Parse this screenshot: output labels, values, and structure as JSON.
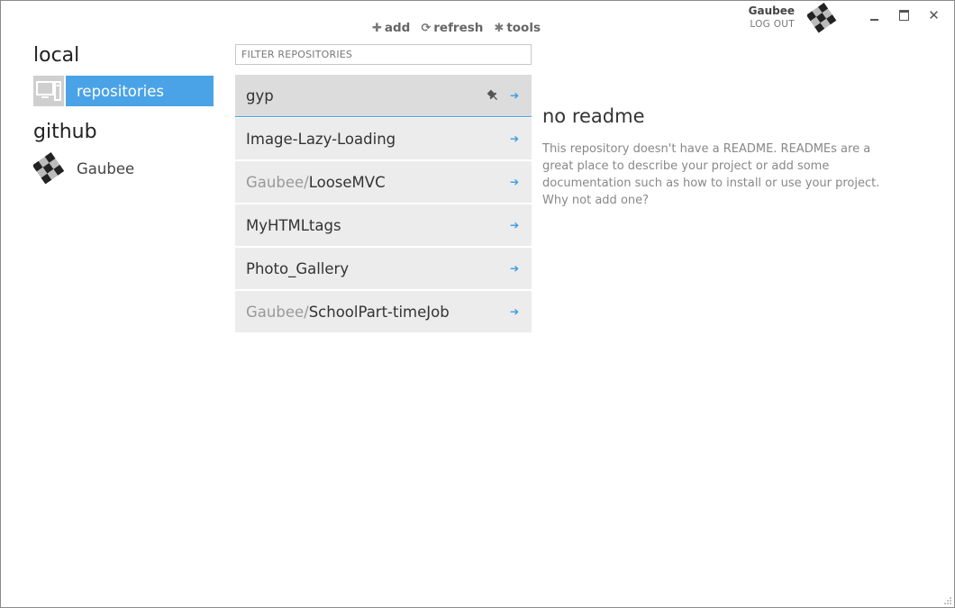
{
  "user": {
    "name": "Gaubee",
    "logout_label": "LOG OUT"
  },
  "toolbar": {
    "add_label": "add",
    "refresh_label": "refresh",
    "tools_label": "tools"
  },
  "sidebar": {
    "local_title": "local",
    "repositories_label": "repositories",
    "github_title": "github",
    "github_account": "Gaubee"
  },
  "filter": {
    "placeholder": "FILTER REPOSITORIES"
  },
  "repos": [
    {
      "owner": "",
      "name": "gyp",
      "selected": true,
      "pinned": true
    },
    {
      "owner": "",
      "name": "Image-Lazy-Loading"
    },
    {
      "owner": "Gaubee/",
      "name": "LooseMVC"
    },
    {
      "owner": "",
      "name": "MyHTMLtags"
    },
    {
      "owner": "",
      "name": "Photo_Gallery"
    },
    {
      "owner": "Gaubee/",
      "name": "SchoolPart-timeJob"
    }
  ],
  "readme": {
    "title": "no readme",
    "body": "This repository doesn't have a README. READMEs are a great place to describe your project or add some documentation such as how to install or use your project. Why not add one?"
  },
  "colors": {
    "accent": "#4aa3e6",
    "arrow": "#3a9ae0",
    "row_bg": "#ececec",
    "row_selected_bg": "#dcdcdc"
  },
  "icons": {
    "add": "plus-icon",
    "refresh": "refresh-icon",
    "tools": "gear-icon",
    "local": "computer-icon",
    "pin": "pin-icon",
    "open": "arrow-right-icon"
  }
}
